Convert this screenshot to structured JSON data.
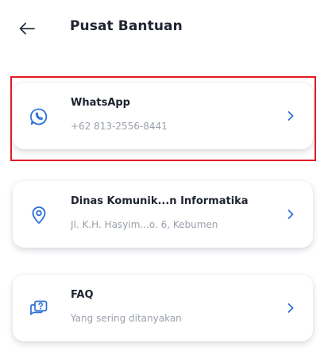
{
  "header": {
    "title": "Pusat Bantuan",
    "back_icon": "arrow-left-icon"
  },
  "colors": {
    "accent": "#2a6fd6",
    "highlight": "#e01b24",
    "title_text": "#1e2430",
    "subtitle_text": "#9aa0ab"
  },
  "cards": [
    {
      "icon": "whatsapp-icon",
      "title": "WhatsApp",
      "subtitle": "+62 813-2556-8441"
    },
    {
      "icon": "location-pin-icon",
      "title": "Dinas Komunik...n Informatika",
      "subtitle": "Jl. K.H. Hasyim...o. 6, Kebumen"
    },
    {
      "icon": "help-chat-icon",
      "title": "FAQ",
      "subtitle": "Yang sering ditanyakan"
    }
  ]
}
